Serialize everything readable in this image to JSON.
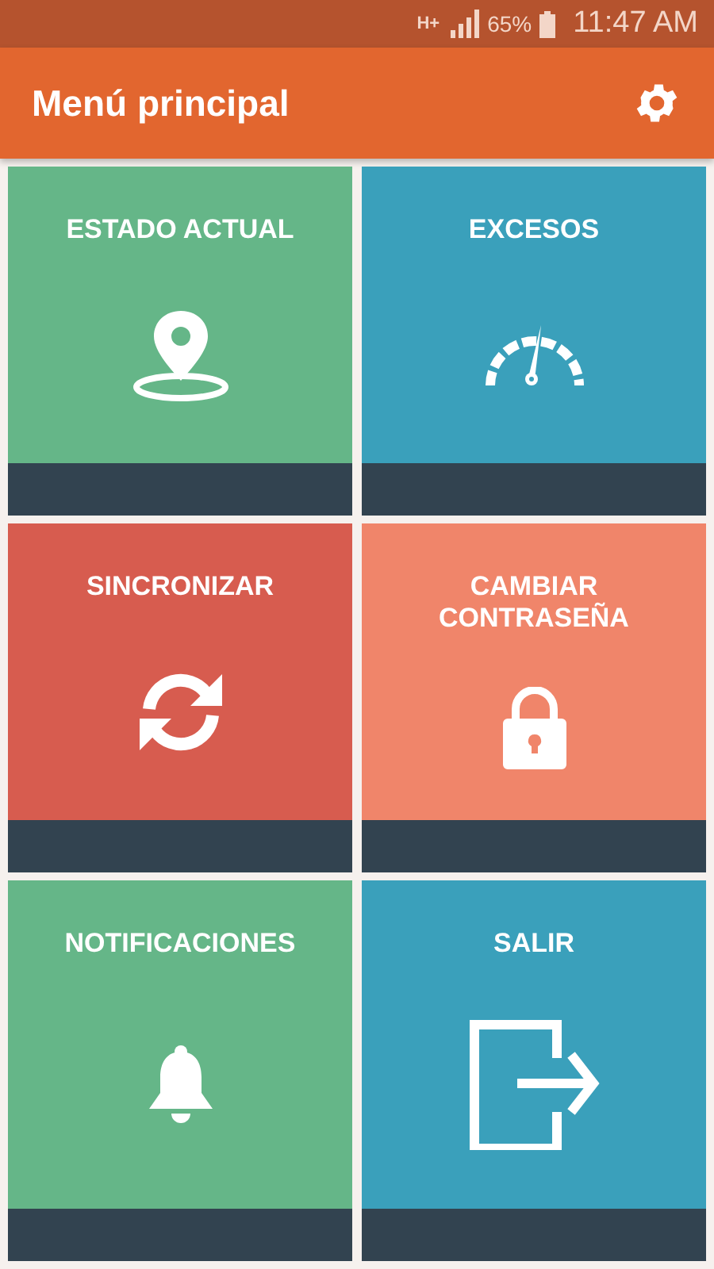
{
  "status_bar": {
    "network": "H+",
    "battery": "65%",
    "time": "11:47 AM"
  },
  "app_bar": {
    "title": "Menú principal"
  },
  "tiles": [
    {
      "label": "ESTADO ACTUAL",
      "kind": "location",
      "color": "#65b688"
    },
    {
      "label": "EXCESOS",
      "kind": "speedometer",
      "color": "#3aa0bb"
    },
    {
      "label": "SINCRONIZAR",
      "kind": "sync",
      "color": "#d75c4f"
    },
    {
      "label": "CAMBIAR CONTRASEÑA",
      "kind": "lock",
      "color": "#f0856a"
    },
    {
      "label": "NOTIFICACIONES",
      "kind": "bell",
      "color": "#65b688"
    },
    {
      "label": "SALIR",
      "kind": "exit",
      "color": "#3aa0bb"
    }
  ]
}
